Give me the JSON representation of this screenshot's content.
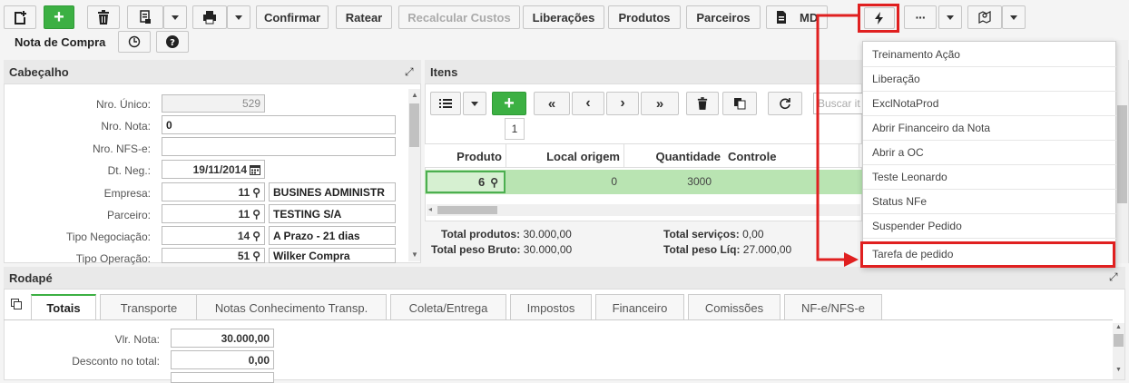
{
  "toolbar": {
    "confirm_label": "Confirmar",
    "ratear_label": "Ratear",
    "recalc_label": "Recalcular Custos",
    "liberacoes_label": "Liberações",
    "produtos_label": "Produtos",
    "parceiros_label": "Parceiros",
    "md_label": "MD",
    "more_label": "···"
  },
  "title_bar": {
    "title": "Nota de Compra"
  },
  "cabecalho": {
    "title": "Cabeçalho",
    "fields": {
      "nro_unico_label": "Nro. Único:",
      "nro_unico_value": "529",
      "nro_nota_label": "Nro. Nota:",
      "nro_nota_value": "0",
      "nro_nfse_label": "Nro. NFS-e:",
      "nro_nfse_value": "",
      "dt_neg_label": "Dt. Neg.:",
      "dt_neg_value": "19/11/2014",
      "empresa_label": "Empresa:",
      "empresa_code": "11",
      "empresa_name": "BUSINES ADMINISTR",
      "parceiro_label": "Parceiro:",
      "parceiro_code": "11",
      "parceiro_name": "TESTING S/A",
      "tipo_neg_label": "Tipo Negociação:",
      "tipo_neg_code": "14",
      "tipo_neg_name": "A Prazo - 21 dias",
      "tipo_op_label": "Tipo Operação:",
      "tipo_op_code": "51",
      "tipo_op_name": "Wilker Compra"
    }
  },
  "itens": {
    "title": "Itens",
    "page_number": "1",
    "search_placeholder": "Buscar it",
    "columns": [
      "Produto",
      "Local origem",
      "Quantidade",
      "Controle"
    ],
    "row": {
      "produto": "6",
      "local": "0",
      "quantidade": "3000",
      "controle": ""
    },
    "totals": {
      "produtos_label": "Total produtos:",
      "produtos_value": "30.000,00",
      "servicos_label": "Total serviços:",
      "servicos_value": "0,00",
      "peso_bruto_label": "Total peso Bruto:",
      "peso_bruto_value": "30.000,00",
      "peso_liq_label": "Total peso Líq:",
      "peso_liq_value": "27.000,00"
    }
  },
  "menu": {
    "items": [
      "Treinamento Ação",
      "Liberação",
      "ExclNotaProd",
      "Abrir Financeiro da Nota",
      "Abrir a OC",
      "Teste Leonardo",
      "Status NFe",
      "Suspender Pedido",
      "Tarefa de pedido"
    ]
  },
  "rodape": {
    "title": "Rodapé",
    "tabs": [
      "Totais",
      "Transporte",
      "Notas Conhecimento Transp.",
      "Coleta/Entrega",
      "Impostos",
      "Financeiro",
      "Comissões",
      "NF-e/NFS-e"
    ],
    "vlr_nota_label": "Vlr. Nota:",
    "vlr_nota_value": "30.000,00",
    "desconto_label": "Desconto no total:",
    "desconto_value": "0,00"
  },
  "colors": {
    "accent_green": "#3cb043",
    "highlight_red": "#e02020",
    "row_green": "#b9e4b2"
  }
}
